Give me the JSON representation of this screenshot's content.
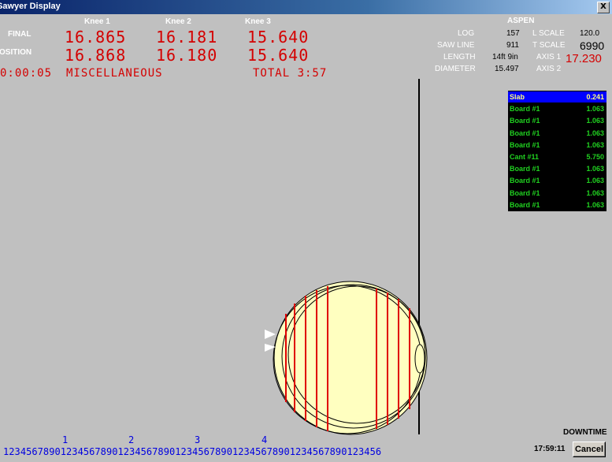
{
  "window": {
    "title": "Sawyer Display",
    "close_label": "X"
  },
  "knees": {
    "headers": [
      "Knee 1",
      "Knee 2",
      "Knee 3"
    ],
    "final_label": "FINAL",
    "position_label": "OSITION",
    "final": [
      "16.865",
      "16.181",
      "15.640"
    ],
    "position": [
      "16.868",
      "16.180",
      "15.640"
    ]
  },
  "status": {
    "timer": "0:00:05",
    "mode": "MISCELLANEOUS",
    "total": "TOTAL 3:57"
  },
  "species": "ASPEN",
  "log_info": {
    "log_label": "LOG",
    "log_value": "157",
    "saw_line_label": "SAW LINE",
    "saw_line_value": "911",
    "length_label": "LENGTH",
    "length_value": "14ft 9in",
    "diameter_label": "DIAMETER",
    "diameter_value": "15.497",
    "l_scale_label": "L SCALE",
    "l_scale_value": "120.0",
    "t_scale_label": "T SCALE",
    "t_scale_value": "6990",
    "axis1_label": "AXIS 1",
    "axis1_value": "17.230",
    "axis2_label": "AXIS 2"
  },
  "cut_list": [
    {
      "name": "Slab",
      "value": "0.241",
      "selected": true
    },
    {
      "name": "Board #1",
      "value": "1.063"
    },
    {
      "name": "Board #1",
      "value": "1.063"
    },
    {
      "name": "Board #1",
      "value": "1.063"
    },
    {
      "name": "Board #1",
      "value": "1.063"
    },
    {
      "name": "Cant  #11",
      "value": "5.750"
    },
    {
      "name": "Board #1",
      "value": "1.063"
    },
    {
      "name": "Board #1",
      "value": "1.063"
    },
    {
      "name": "Board #1",
      "value": "1.063"
    },
    {
      "name": "Board #1",
      "value": "1.063"
    }
  ],
  "ruler": {
    "major": [
      "1",
      "2",
      "3",
      "4"
    ],
    "digits": "123456789012345678901234567890123456789012345678901234567890123456"
  },
  "footer": {
    "downtime": "DOWNTIME",
    "clock": "17:59:11",
    "cancel_label": "Cancel"
  },
  "colors": {
    "cut_line": "#e00000",
    "log_fill": "#ffffc0",
    "saw_line": "#000000",
    "background": "#c0c0c0"
  }
}
